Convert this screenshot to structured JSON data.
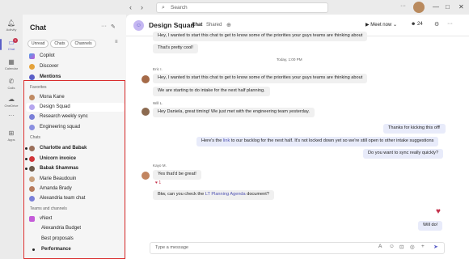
{
  "titlebar": {
    "back_icon": "chevron-left-icon",
    "forward_icon": "chevron-right-icon",
    "search_placeholder": "Search",
    "search_icon": "search-icon",
    "more_icon": "more-icon",
    "minimize": "—",
    "maximize": "□",
    "close": "✕"
  },
  "rail": {
    "activity": "Activity",
    "chat": "Chat",
    "chat_badge": "1",
    "calendar": "Calendar",
    "calls": "Calls",
    "onedrive": "OneDrive",
    "apps": "Apps"
  },
  "panel": {
    "title": "Chat",
    "filters": [
      "Unread",
      "Chats",
      "Channels"
    ],
    "top_items": [
      "Copilot",
      "Discover",
      "Mentions"
    ],
    "favorites_label": "Favorites",
    "favorites": [
      "Mona Kane",
      "Design Squad",
      "Research weekly sync",
      "Engineering squad"
    ],
    "chats_label": "Chats",
    "chats": [
      "Charlotte and Babak",
      "Unicorn invoice",
      "Babak Shammas",
      "Marie Beaudouin",
      "Amanda Brady",
      "Alexandria team chat"
    ],
    "teams_label": "Teams and channels",
    "teams": [
      "vNext",
      "Alexandria Budget",
      "Best proposals",
      "Performance"
    ]
  },
  "header": {
    "title": "Design Squad",
    "tab_chat": "Chat",
    "tab_shared": "Shared",
    "meet_label": "Meet now",
    "participants": "24"
  },
  "messages": {
    "m1": "Hey, I wanted to start this chat to get to know some of the priorities your guys teams are thinking about",
    "m2": "That's pretty cool!",
    "time": "Today, 1:00 PM",
    "s1": "Eric I.",
    "m3": "Hey, I wanted to start this chat to get to know some of the priorities your guys teams are thinking about",
    "m4": "We are starting to do intake for the next half planning.",
    "s2": "Will L.",
    "m5": "Hey Daniela, great timing! We just met with the engineering team yesterday.",
    "o1": "Thanks for kicking this off!",
    "o2a": "Here's the ",
    "o2link": "link",
    "o2b": " to our backlog for the next half. It's not locked down yet so we're still open to other intake suggestions",
    "o3": "Do you want to sync really quickly?",
    "s3": "Kayo M.",
    "m6": "Yes that'd be great!",
    "reaction": "♥ 1",
    "m7a": "Btw, can you check the ",
    "m7link": "LT Planning Agenda",
    "m7b": " document?",
    "o4": "Will do!"
  },
  "compose": {
    "placeholder": "Type a message"
  },
  "colors": {
    "accent": "#5b5fc7",
    "highlight": "#d92c2c"
  }
}
